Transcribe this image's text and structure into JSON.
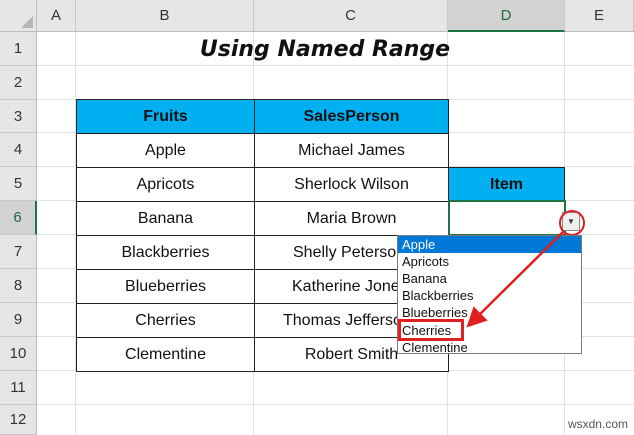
{
  "columns": [
    "A",
    "B",
    "C",
    "D",
    "E"
  ],
  "rows": [
    "1",
    "2",
    "3",
    "4",
    "5",
    "6",
    "7",
    "8",
    "9",
    "10",
    "11",
    "12"
  ],
  "title": "Using Named Range",
  "table": {
    "headers": [
      "Fruits",
      "SalesPerson"
    ],
    "rows": [
      [
        "Apple",
        "Michael James"
      ],
      [
        "Apricots",
        "Sherlock Wilson"
      ],
      [
        "Banana",
        "Maria Brown"
      ],
      [
        "Blackberries",
        "Shelly Peterson"
      ],
      [
        "Blueberries",
        "Katherine Jones"
      ],
      [
        "Cherries",
        "Thomas Jefferson"
      ],
      [
        "Clementine",
        "Robert Smith"
      ]
    ]
  },
  "item_header": "Item",
  "item_value": "",
  "dropdown": {
    "items": [
      "Apple",
      "Apricots",
      "Banana",
      "Blackberries",
      "Blueberries",
      "Cherries",
      "Clementine"
    ],
    "selected_index": 0,
    "highlighted_item": "Cherries"
  },
  "dropdown_arrow": "▼",
  "watermark": "wsxdn.com",
  "colors": {
    "header_fill": "#00b0f0",
    "selection_green": "#217346",
    "annotation_red": "#e02020",
    "list_selection": "#0078d7"
  }
}
